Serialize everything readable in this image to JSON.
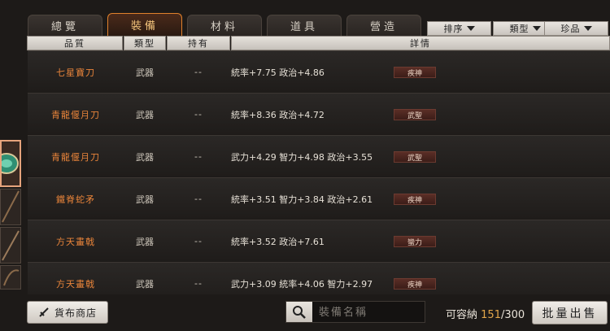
{
  "tabs": [
    "總覽",
    "裝備",
    "材料",
    "道具",
    "營造"
  ],
  "active_tab": 1,
  "filters": [
    "排序",
    "類型",
    "珍品"
  ],
  "columns": [
    "品質",
    "類型",
    "持有",
    "詳情"
  ],
  "rows": [
    {
      "name": "七星寶刀",
      "type": "武器",
      "owned": "--",
      "stats": "統率+7.75  政治+4.86",
      "skill": "疾神"
    },
    {
      "name": "青龍偃月刀",
      "type": "武器",
      "owned": "--",
      "stats": "統率+8.36  政治+4.72",
      "skill": "武聖"
    },
    {
      "name": "青龍偃月刀",
      "type": "武器",
      "owned": "--",
      "stats": "武力+4.29  智力+4.98  政治+3.55",
      "skill": "武聖"
    },
    {
      "name": "鐵脊蛇矛",
      "type": "武器",
      "owned": "--",
      "stats": "統率+3.51  智力+3.84  政治+2.61",
      "skill": "疾神"
    },
    {
      "name": "方天畫戟",
      "type": "武器",
      "owned": "--",
      "stats": "統率+3.52  政治+7.61",
      "skill": "蠻力"
    },
    {
      "name": "方天畫戟",
      "type": "武器",
      "owned": "--",
      "stats": "武力+3.09  統率+4.06  智力+2.97",
      "skill": "疾神"
    }
  ],
  "footer": {
    "shop_label": "貨布商店",
    "search_placeholder": "裝備名稱",
    "capacity_label": "可容納",
    "capacity_current": "151",
    "capacity_max": "/300",
    "sell_label": "批量出售"
  },
  "colors": {
    "accent": "#e0812c",
    "item_name": "#e8843a",
    "capacity": "#e3a64a"
  },
  "icons": {
    "search": "magnifier-icon",
    "shop": "shop-sword-icon",
    "dropdown": "triangle-down-icon"
  }
}
